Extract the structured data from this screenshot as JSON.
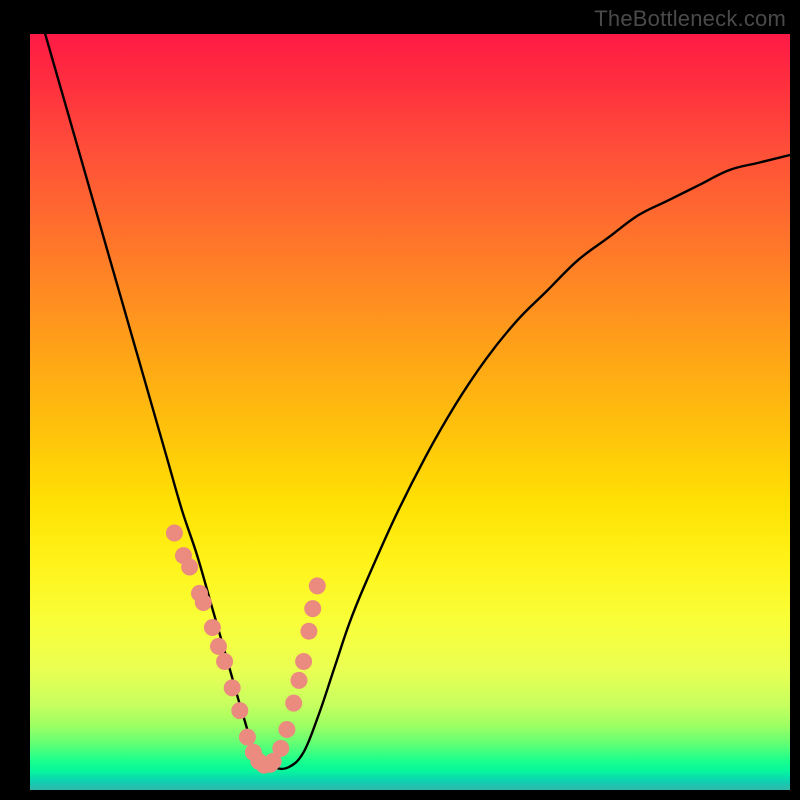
{
  "watermark": "TheBottleneck.com",
  "chart_data": {
    "type": "line",
    "title": "",
    "xlabel": "",
    "ylabel": "",
    "xlim": [
      0,
      100
    ],
    "ylim": [
      0,
      100
    ],
    "note": "Axes are unlabeled in the source image; values below are percentages of the visible plot area (0 = left/bottom, 100 = right/top). The curve is a V-shaped profile with a flat minimum around x≈28–32 and y≈3.",
    "series": [
      {
        "name": "curve",
        "x": [
          2,
          4,
          6,
          8,
          10,
          12,
          14,
          16,
          18,
          20,
          22,
          24,
          26,
          28,
          30,
          32,
          34,
          36,
          38,
          40,
          42,
          44,
          48,
          52,
          56,
          60,
          64,
          68,
          72,
          76,
          80,
          84,
          88,
          92,
          96,
          100
        ],
        "y": [
          100,
          93,
          86,
          79,
          72,
          65,
          58,
          51,
          44,
          37,
          31,
          24,
          17,
          10,
          4,
          3,
          3,
          5,
          10,
          16,
          22,
          27,
          36,
          44,
          51,
          57,
          62,
          66,
          70,
          73,
          76,
          78,
          80,
          82,
          83,
          84
        ]
      }
    ],
    "highlight_points": {
      "name": "markers-near-minimum",
      "note": "salmon-colored circular markers clustered on both arms of the V near the bottom",
      "x": [
        19.0,
        20.2,
        21.0,
        22.3,
        22.8,
        24.0,
        24.8,
        25.6,
        26.6,
        27.6,
        28.6,
        29.4,
        30.1,
        30.8,
        31.6,
        32.0,
        33.0,
        33.8,
        34.7,
        35.4,
        36.0,
        36.7,
        37.2,
        37.8
      ],
      "y": [
        34.0,
        31.0,
        29.5,
        26.0,
        24.8,
        21.5,
        19.0,
        17.0,
        13.5,
        10.5,
        7.0,
        5.0,
        3.8,
        3.3,
        3.4,
        3.8,
        5.5,
        8.0,
        11.5,
        14.5,
        17.0,
        21.0,
        24.0,
        27.0
      ]
    },
    "colors": {
      "curve": "#000000",
      "markers": "#eb8b80",
      "gradient_top": "#ff1a46",
      "gradient_mid": "#ffd400",
      "gradient_bottom": "#1fb9a9"
    }
  }
}
